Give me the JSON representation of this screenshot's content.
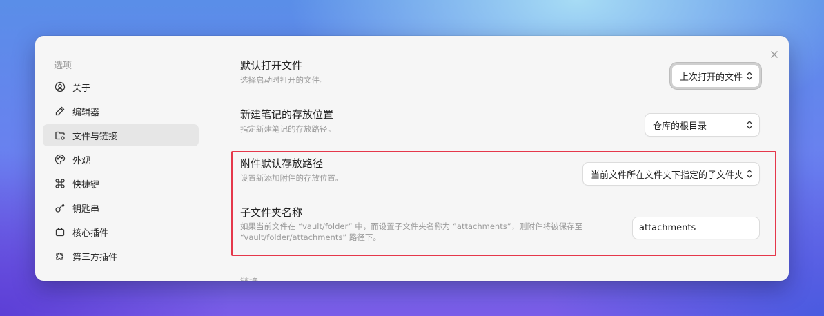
{
  "sidebar": {
    "heading": "选项",
    "items": [
      {
        "label": "关于",
        "icon": "user-circle-icon"
      },
      {
        "label": "编辑器",
        "icon": "pencil-icon"
      },
      {
        "label": "文件与链接",
        "icon": "folder-cog-icon",
        "active": true
      },
      {
        "label": "外观",
        "icon": "palette-icon"
      },
      {
        "label": "快捷键",
        "icon": "command-icon"
      },
      {
        "label": "钥匙串",
        "icon": "key-icon"
      },
      {
        "label": "核心插件",
        "icon": "plug-icon"
      },
      {
        "label": "第三方插件",
        "icon": "puzzle-icon"
      }
    ]
  },
  "settings": {
    "default_open_file": {
      "name": "默认打开文件",
      "desc": "选择启动时打开的文件。",
      "value": "上次打开的文件"
    },
    "new_note_location": {
      "name": "新建笔记的存放位置",
      "desc": "指定新建笔记的存放路径。",
      "value": "仓库的根目录"
    },
    "attachment_location": {
      "name": "附件默认存放路径",
      "desc": "设置新添加附件的存放位置。",
      "value": "当前文件所在文件夹下指定的子文件夹"
    },
    "subfolder_name": {
      "name": "子文件夹名称",
      "desc_line1": "如果当前文件在 “vault/folder” 中，而设置子文件夹名称为 “attachments”，则附件将被保存至",
      "desc_line2": "“vault/folder/attachments” 路径下。",
      "value": "attachments"
    }
  },
  "next_section_heading": "链接",
  "colors": {
    "highlight_border": "#e5384b",
    "active_nav_bg": "#e6e6e6",
    "dialog_bg": "#f6f6f6"
  }
}
